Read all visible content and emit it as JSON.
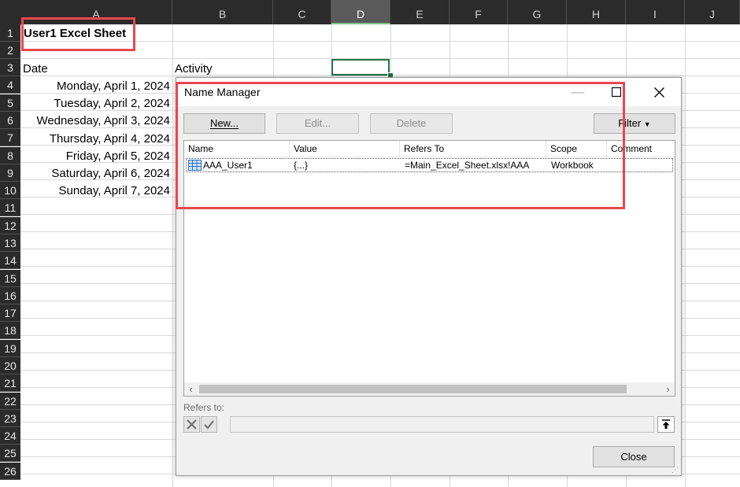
{
  "sheet": {
    "columns": [
      "A",
      "B",
      "C",
      "D",
      "E",
      "F",
      "G",
      "H",
      "I",
      "J"
    ],
    "selected_column": "D",
    "rows": [
      "1",
      "2",
      "3",
      "4",
      "5",
      "6",
      "7",
      "8",
      "9",
      "10",
      "11",
      "12",
      "13",
      "14",
      "15",
      "16",
      "17",
      "18",
      "19",
      "20",
      "21",
      "22",
      "23",
      "24",
      "25",
      "26"
    ],
    "title_cell": "User1 Excel Sheet",
    "header_date": "Date",
    "header_activity": "Activity",
    "dates": [
      "Monday, April 1, 2024",
      "Tuesday, April 2, 2024",
      "Wednesday, April 3, 2024",
      "Thursday, April 4, 2024",
      "Friday, April 5, 2024",
      "Saturday, April 6, 2024",
      "Sunday, April 7, 2024"
    ]
  },
  "dialog": {
    "title": "Name Manager",
    "buttons": {
      "new": "New...",
      "edit": "Edit...",
      "delete": "Delete",
      "filter": "Filter"
    },
    "columns": [
      "Name",
      "Value",
      "Refers To",
      "Scope",
      "Comment"
    ],
    "rows": [
      {
        "name": "AAA_User1",
        "value": "{...}",
        "refers_to": "=Main_Excel_Sheet.xlsx!AAA",
        "scope": "Workbook",
        "comment": ""
      }
    ],
    "refers_to_label": "Refers to:",
    "refers_to_value": "",
    "close": "Close"
  },
  "colors": {
    "highlight": "#e8474f",
    "active_cell": "#217346",
    "header_bg": "#2b2b2b"
  }
}
